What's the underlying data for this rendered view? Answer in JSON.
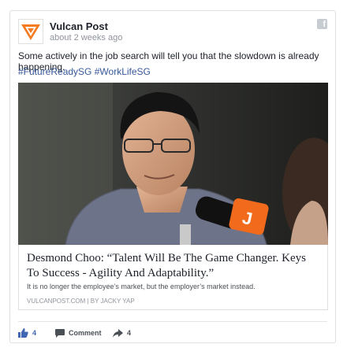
{
  "post": {
    "page_name": "Vulcan Post",
    "timestamp": "about 2 weeks ago",
    "message": "Some actively in the job search will tell you that the slowdown is already happening.",
    "hashtags": [
      "#FutureReadySG",
      "#WorkLifeSG"
    ]
  },
  "link": {
    "title": "Desmond Choo: “Talent Will Be The Game Changer. Keys To Success - Agility And Adaptability.”",
    "description": "It is no longer the employee’s market, but the employer’s market instead.",
    "domain": "VULCANPOST.COM",
    "separator": "|",
    "by_label": "BY",
    "author": "JACKY YAP"
  },
  "actions": {
    "like_count": "4",
    "comment_label": "Comment",
    "share_count": "4"
  },
  "colors": {
    "brand_orange": "#f47b20",
    "link_blue": "#365899",
    "like_blue": "#4267b2",
    "microphone_accent": "#f26b1d"
  },
  "icons": {
    "logo": "vulcan-post-logo",
    "platform": "facebook-icon",
    "like": "thumbs-up-icon",
    "comment": "comment-bubble-icon",
    "share": "share-arrow-icon"
  }
}
